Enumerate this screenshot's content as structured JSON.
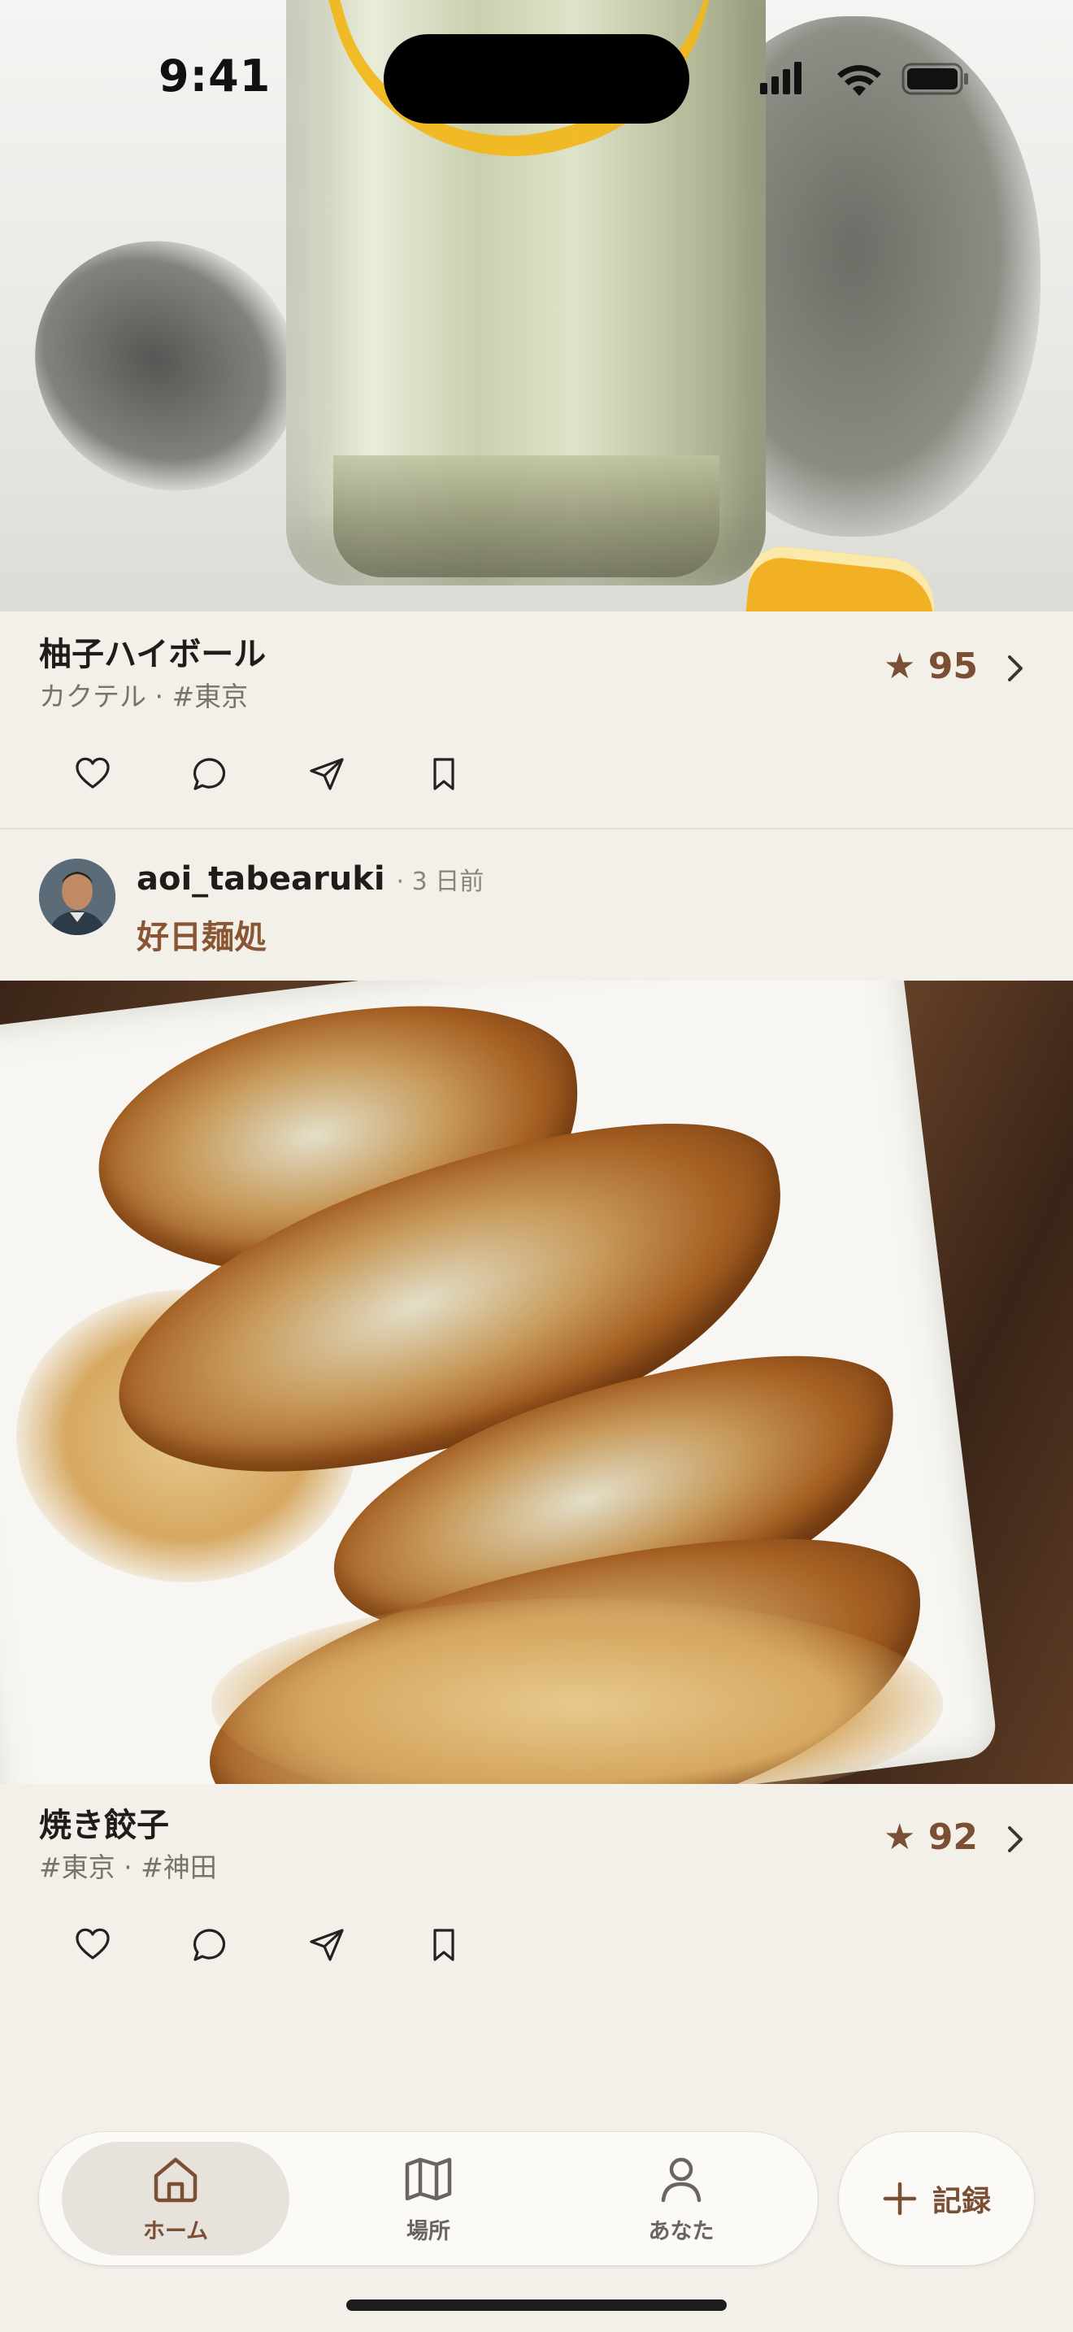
{
  "status_bar": {
    "time": "9:41"
  },
  "posts": [
    {
      "dish": "柚子ハイボール",
      "tags": "カクテル · #東京",
      "score": "★ 95"
    },
    {
      "user": "aoi_tabearuki",
      "ago": "· 3 日前",
      "place": "好日麺処",
      "dish": "焼き餃子",
      "tags": "#東京 · #神田",
      "score": "★ 92"
    }
  ],
  "tabbar": {
    "tabs": [
      {
        "label": "ホーム",
        "icon": "home-icon",
        "active": true
      },
      {
        "label": "場所",
        "icon": "map-icon",
        "active": false
      },
      {
        "label": "あなた",
        "icon": "person-icon",
        "active": false
      }
    ],
    "record_label": "記録"
  },
  "colors": {
    "accent": "#7b4f34",
    "background": "#f3f0ea"
  }
}
